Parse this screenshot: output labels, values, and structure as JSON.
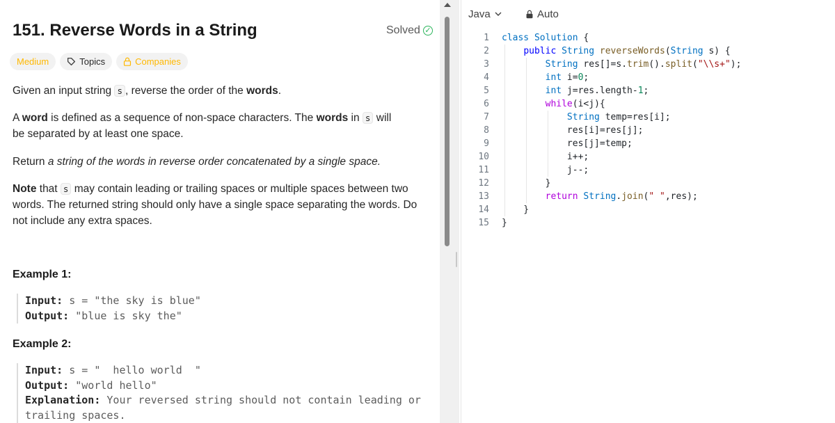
{
  "problem": {
    "title": "151. Reverse Words in a String",
    "status_label": "Solved",
    "tags": {
      "difficulty": "Medium",
      "topics": "Topics",
      "companies": "Companies"
    },
    "description": {
      "p1_before": "Given an input string ",
      "p1_code": "s",
      "p1_after": ", reverse the order of the ",
      "p1_bold": "words",
      "p1_end": ".",
      "p2_a": "A ",
      "p2_bold1": "word",
      "p2_b": " is defined as a sequence of non-space characters. The ",
      "p2_bold2": "words",
      "p2_c": " in ",
      "p2_code": "s",
      "p2_d": " will be separated by at least one space.",
      "p3_a": "Return ",
      "p3_italic": "a string of the words in reverse order concatenated by a single space.",
      "p4_bold": "Note",
      "p4_a": " that ",
      "p4_code": "s",
      "p4_b": " may contain leading or trailing spaces or multiple spaces between two words. The returned string should only have a single space separating the words. Do not include any extra spaces."
    },
    "examples": [
      {
        "title": "Example 1:",
        "input_label": "Input:",
        "input_value": "s = \"the sky is blue\"",
        "output_label": "Output:",
        "output_value": "\"blue is sky the\""
      },
      {
        "title": "Example 2:",
        "input_label": "Input:",
        "input_value": "s = \"  hello world  \"",
        "output_label": "Output:",
        "output_value": "\"world hello\"",
        "explanation_label": "Explanation:",
        "explanation_value": "Your reversed string should not contain leading or trailing spaces."
      }
    ]
  },
  "editor": {
    "language": "Java",
    "mode": "Auto",
    "lines": [
      "1",
      "2",
      "3",
      "4",
      "5",
      "6",
      "7",
      "8",
      "9",
      "10",
      "11",
      "12",
      "13",
      "14",
      "15"
    ]
  },
  "colors": {
    "difficulty_medium": "#ffb800",
    "solved_green": "#2db55d",
    "keyword_blue": "#0000ff",
    "string_red": "#a31515"
  }
}
